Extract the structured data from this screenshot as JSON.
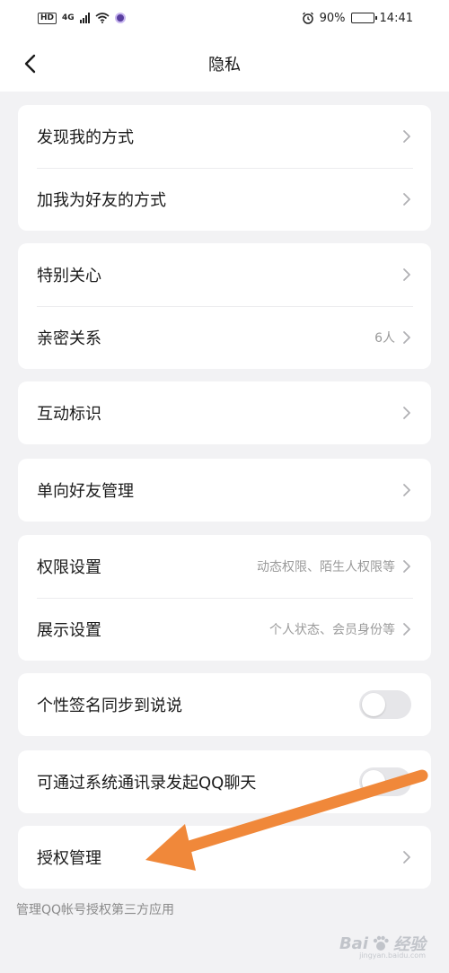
{
  "status_bar": {
    "hd_badge": "HD",
    "network": "4G",
    "battery_percent": "90%",
    "battery_level": 0.9,
    "time": "14:41"
  },
  "navbar": {
    "back_icon": "chevron-left-icon",
    "title": "隐私"
  },
  "groups": [
    {
      "rows": [
        {
          "label": "发现我的方式",
          "hint": "",
          "control": "chevron"
        },
        {
          "label": "加我为好友的方式",
          "hint": "",
          "control": "chevron"
        }
      ]
    },
    {
      "rows": [
        {
          "label": "特别关心",
          "hint": "",
          "control": "chevron"
        },
        {
          "label": "亲密关系",
          "hint": "6人",
          "control": "chevron"
        }
      ]
    },
    {
      "rows": [
        {
          "label": "互动标识",
          "hint": "",
          "control": "chevron"
        }
      ]
    },
    {
      "rows": [
        {
          "label": "单向好友管理",
          "hint": "",
          "control": "chevron"
        }
      ]
    },
    {
      "rows": [
        {
          "label": "权限设置",
          "hint": "动态权限、陌生人权限等",
          "control": "chevron"
        },
        {
          "label": "展示设置",
          "hint": "个人状态、会员身份等",
          "control": "chevron"
        }
      ]
    },
    {
      "rows": [
        {
          "label": "个性签名同步到说说",
          "hint": "",
          "control": "toggle",
          "on": false
        }
      ]
    },
    {
      "rows": [
        {
          "label": "可通过系统通讯录发起QQ聊天",
          "hint": "",
          "control": "toggle",
          "on": false
        }
      ]
    },
    {
      "rows": [
        {
          "label": "授权管理",
          "hint": "",
          "control": "chevron"
        }
      ]
    }
  ],
  "footnote": "管理QQ帐号授权第三方应用",
  "annotation": {
    "arrow_color": "#f0883a"
  },
  "watermark": {
    "brand": "Bai",
    "suffix": "经验",
    "url": "jingyan.baidu.com"
  },
  "colors": {
    "background": "#f2f2f4",
    "card": "#ffffff",
    "hint_text": "#9a9a9a",
    "toggle_off": "#e6e6e9"
  }
}
